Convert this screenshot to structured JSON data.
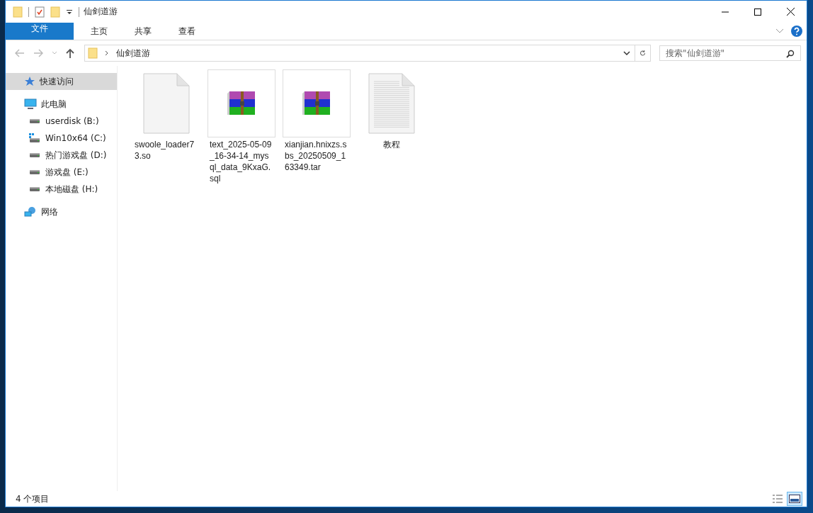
{
  "window": {
    "title": "仙剑道游"
  },
  "ribbon_tabs": [
    {
      "label": "文件",
      "kind": "file"
    },
    {
      "label": "主页",
      "kind": "tab"
    },
    {
      "label": "共享",
      "kind": "tab"
    },
    {
      "label": "查看",
      "kind": "tab"
    }
  ],
  "address_bar": {
    "path": [
      "仙剑道游"
    ]
  },
  "search": {
    "placeholder": "搜索\"仙剑道游\""
  },
  "sidebar": {
    "items": [
      {
        "label": "快速访问",
        "kind": "star",
        "selected": true
      },
      {
        "label": "此电脑",
        "kind": "pc",
        "selected": false,
        "children": [
          {
            "label": "userdisk (B:)",
            "kind": "drive",
            "selected": false
          },
          {
            "label": "Win10x64 (C:)",
            "kind": "sysdrive",
            "selected": false
          },
          {
            "label": "热门游戏盘 (D:)",
            "kind": "drive",
            "selected": false
          },
          {
            "label": "游戏盘 (E:)",
            "kind": "drive",
            "selected": false
          },
          {
            "label": "本地磁盘 (H:)",
            "kind": "drive",
            "selected": false
          }
        ]
      },
      {
        "label": "网络",
        "kind": "network",
        "selected": false
      }
    ]
  },
  "files": [
    {
      "name": "swoole_loader73.so",
      "kind": "blank"
    },
    {
      "name": "text_2025-05-09_16-34-14_mysql_data_9KxaG.sql",
      "kind": "archive"
    },
    {
      "name": "xianjian.hnixzs.sbs_20250509_163349.tar",
      "kind": "archive"
    },
    {
      "name": "教程",
      "kind": "text"
    }
  ],
  "status_bar": {
    "count": "4 个项目",
    "views": [
      {
        "kind": "details",
        "selected": false
      },
      {
        "kind": "large",
        "selected": true
      }
    ]
  }
}
